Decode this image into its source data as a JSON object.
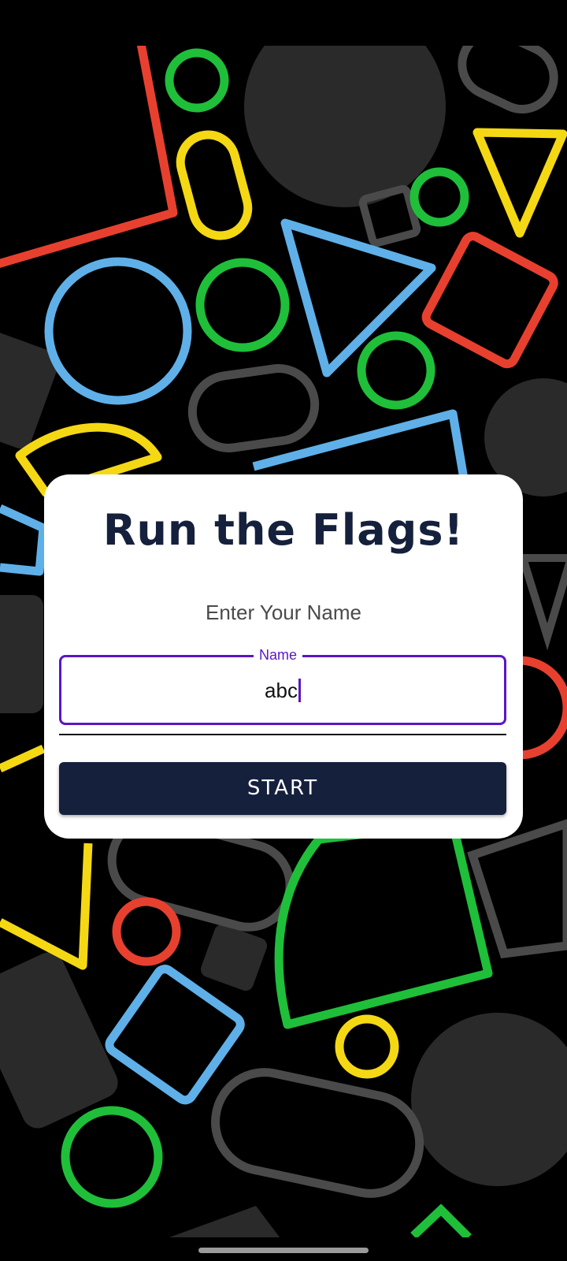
{
  "app": {
    "title": "Run the Flags!",
    "subtitle": "Enter Your Name"
  },
  "name_field": {
    "label": "Name",
    "value": "abc"
  },
  "start_button": {
    "label": "START"
  },
  "colors": {
    "accent": "#5b16c4",
    "primary": "#15203d",
    "background": "#000000",
    "shape_red": "#e8402f",
    "shape_green": "#1fbf3a",
    "shape_yellow": "#f5d814",
    "shape_blue": "#5fb0e8",
    "shape_gray": "#4a4a4a"
  }
}
